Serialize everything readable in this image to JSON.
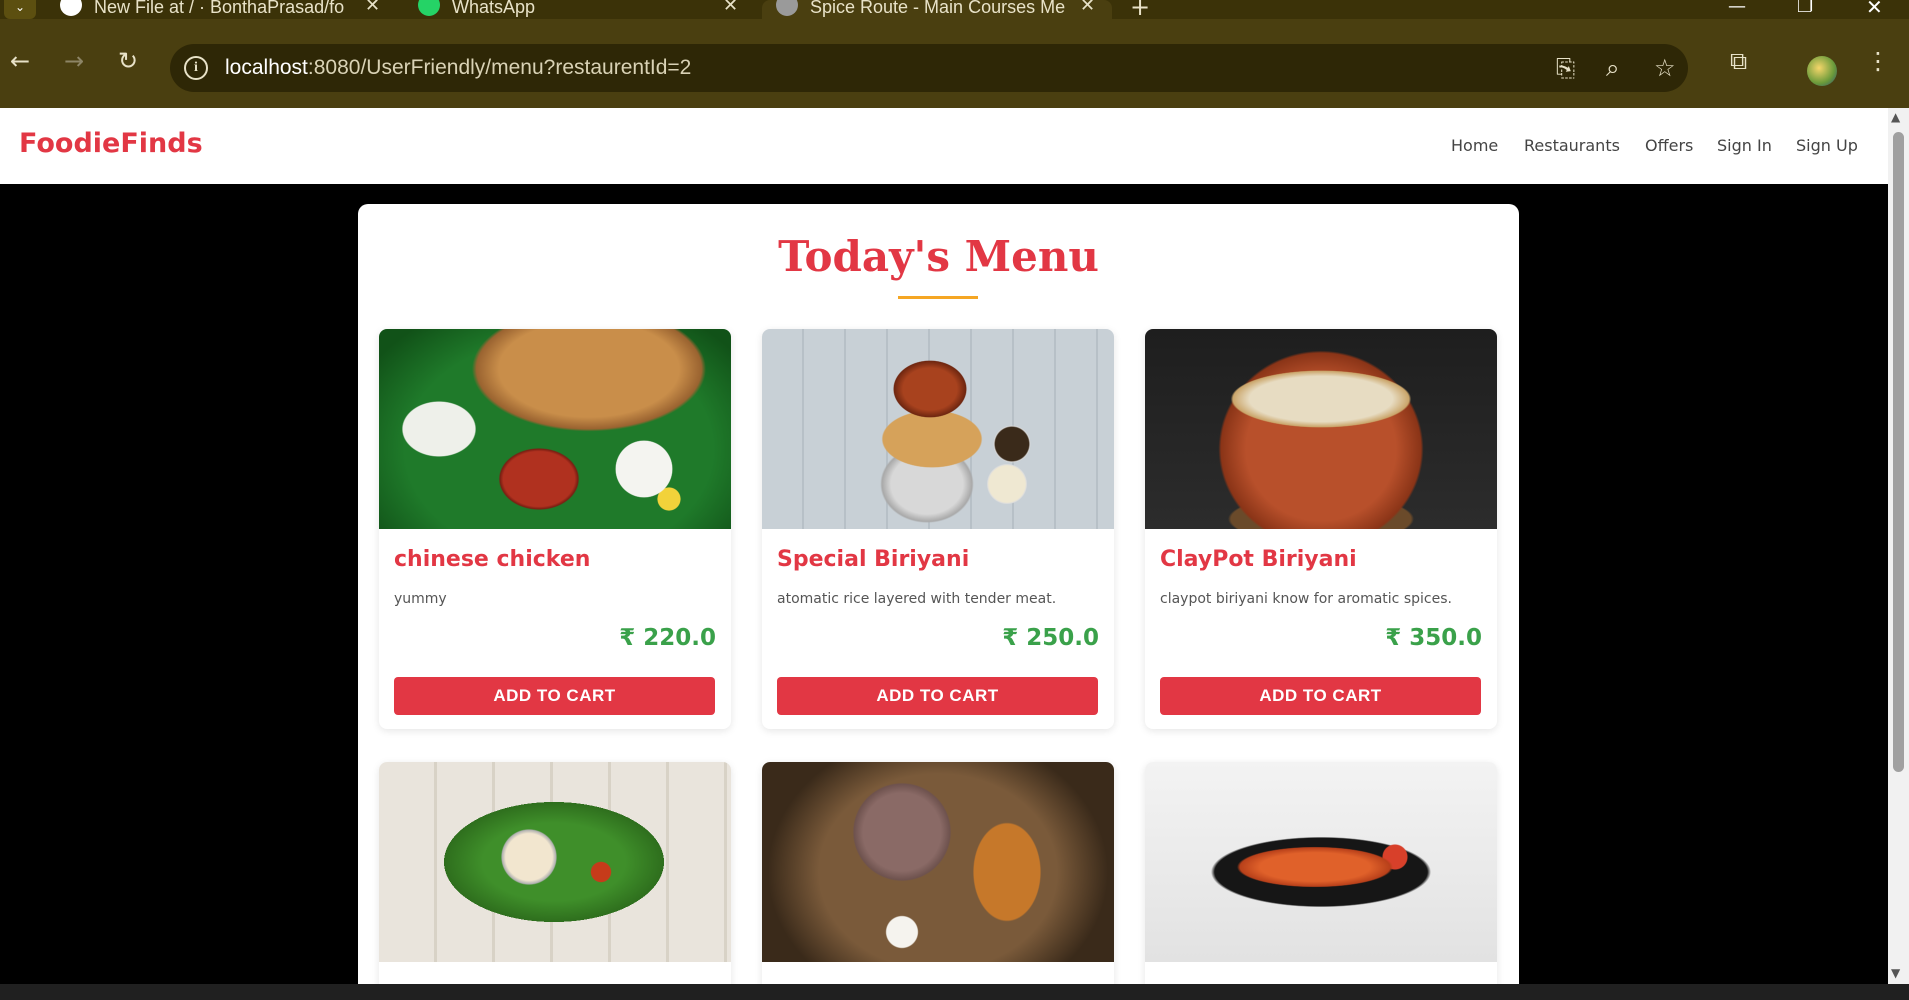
{
  "browser": {
    "tabs": [
      {
        "title": "New File at / · BonthaPrasad/fo",
        "icon": "github-icon"
      },
      {
        "title": "WhatsApp",
        "icon": "whatsapp-icon"
      },
      {
        "title": "Spice Route - Main Courses Me",
        "icon": "globe-icon",
        "active": true
      }
    ],
    "new_tab": "+",
    "url_host": "localhost",
    "url_rest": ":8080/UserFriendly/menu?restaurentId=2"
  },
  "site": {
    "brand": "FoodieFinds",
    "nav": [
      "Home",
      "Restaurants",
      "Offers",
      "Sign In",
      "Sign Up"
    ],
    "menu_title": "Today's Menu",
    "add_to_cart": "ADD TO CART",
    "items": [
      {
        "name": "chinese chicken",
        "desc": "yummy",
        "price": "₹ 220.0"
      },
      {
        "name": "Special Biriyani",
        "desc": "atomatic rice layered with tender meat.",
        "price": "₹ 250.0"
      },
      {
        "name": "ClayPot Biriyani",
        "desc": "claypot biriyani know for aromatic spices.",
        "price": "₹ 350.0"
      },
      {
        "name": "",
        "desc": "",
        "price": ""
      },
      {
        "name": "",
        "desc": "",
        "price": ""
      },
      {
        "name": "",
        "desc": "",
        "price": ""
      }
    ]
  },
  "colors": {
    "brand": "#e23744",
    "price": "#3aa14a",
    "accent": "#f5a623",
    "chrome": "#4a3f10"
  }
}
